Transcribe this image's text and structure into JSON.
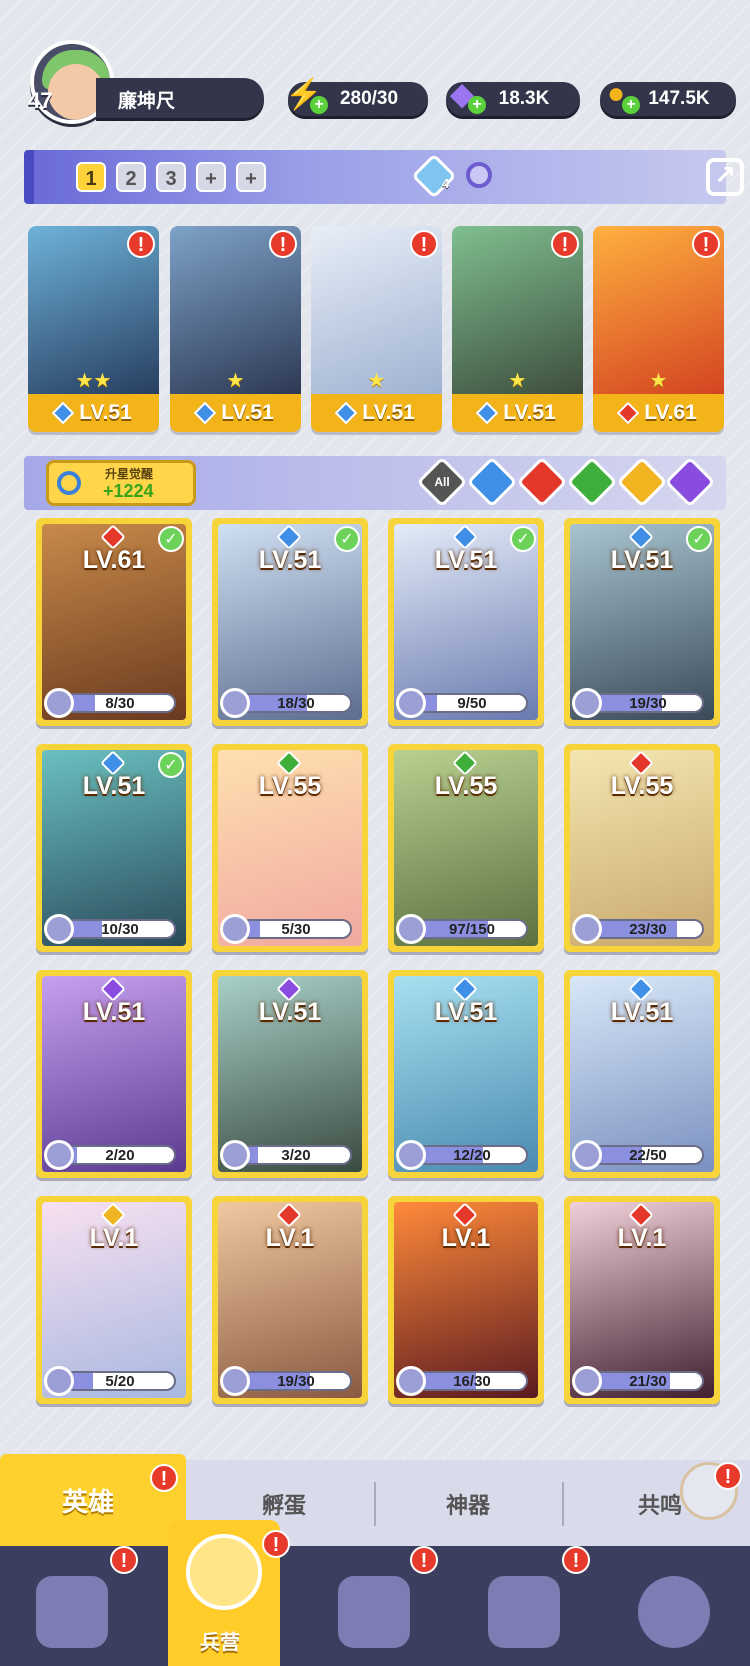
{
  "player": {
    "level": "47",
    "name": "廉坤尺"
  },
  "resources": [
    {
      "id": "energy",
      "value": "280/30",
      "icon": "lightning-icon",
      "color": "#6fdc3a"
    },
    {
      "id": "gems",
      "value": "18.3K",
      "icon": "gem-icon",
      "color": "#9b74f0"
    },
    {
      "id": "gold",
      "value": "147.5K",
      "icon": "coin-icon",
      "color": "#f4b51c"
    }
  ],
  "team": {
    "tabs": [
      "1",
      "2",
      "3",
      "+",
      "+"
    ],
    "active_tab": "1",
    "shield_count": "4",
    "members": [
      {
        "level": "LV.51",
        "element": "water",
        "stars": "★★",
        "alert": "!"
      },
      {
        "level": "LV.51",
        "element": "water",
        "stars": "★",
        "alert": "!"
      },
      {
        "level": "LV.51",
        "element": "water",
        "stars": "★",
        "alert": "!"
      },
      {
        "level": "LV.51",
        "element": "water",
        "stars": "★",
        "alert": "!"
      },
      {
        "level": "LV.61",
        "element": "fire",
        "stars": "★",
        "alert": "!"
      }
    ]
  },
  "awaken": {
    "label": "升星觉醒",
    "value": "+1224"
  },
  "filters": [
    {
      "id": "all",
      "label": "All",
      "color": "#555"
    },
    {
      "id": "water",
      "label": "",
      "color": "#3f8fe6"
    },
    {
      "id": "fire",
      "label": "",
      "color": "#e3382a"
    },
    {
      "id": "nature",
      "label": "",
      "color": "#3fae3a"
    },
    {
      "id": "light",
      "label": "",
      "color": "#f0b420"
    },
    {
      "id": "dark",
      "label": "",
      "color": "#8a4be0"
    }
  ],
  "heroes": [
    {
      "level": "LV.61",
      "element": "fire",
      "progress": "8/30",
      "checked": true
    },
    {
      "level": "LV.51",
      "element": "water",
      "progress": "18/30",
      "checked": true
    },
    {
      "level": "LV.51",
      "element": "water",
      "progress": "9/50",
      "checked": true
    },
    {
      "level": "LV.51",
      "element": "water",
      "progress": "19/30",
      "checked": true
    },
    {
      "level": "LV.51",
      "element": "water",
      "progress": "10/30",
      "checked": true
    },
    {
      "level": "LV.55",
      "element": "nature",
      "progress": "5/30",
      "checked": false
    },
    {
      "level": "LV.55",
      "element": "nature",
      "progress": "97/150",
      "checked": false
    },
    {
      "level": "LV.55",
      "element": "fire",
      "progress": "23/30",
      "checked": false
    },
    {
      "level": "LV.51",
      "element": "dark",
      "progress": "2/20",
      "checked": false
    },
    {
      "level": "LV.51",
      "element": "dark",
      "progress": "3/20",
      "checked": false
    },
    {
      "level": "LV.51",
      "element": "water",
      "progress": "12/20",
      "checked": false
    },
    {
      "level": "LV.51",
      "element": "water",
      "progress": "22/50",
      "checked": false
    },
    {
      "level": "LV.1",
      "element": "light",
      "progress": "5/20",
      "checked": false
    },
    {
      "level": "LV.1",
      "element": "fire",
      "progress": "19/30",
      "checked": false
    },
    {
      "level": "LV.1",
      "element": "fire",
      "progress": "16/30",
      "checked": false
    },
    {
      "level": "LV.1",
      "element": "fire",
      "progress": "21/30",
      "checked": false
    }
  ],
  "subtabs": [
    "英雄",
    "孵蛋",
    "神器",
    "共鸣"
  ],
  "nav": {
    "active_label": "兵营",
    "alert": "!"
  },
  "element_colors": {
    "water": "#3f8fe6",
    "fire": "#e3382a",
    "nature": "#3fae3a",
    "light": "#f0b420",
    "dark": "#8a4be0"
  }
}
